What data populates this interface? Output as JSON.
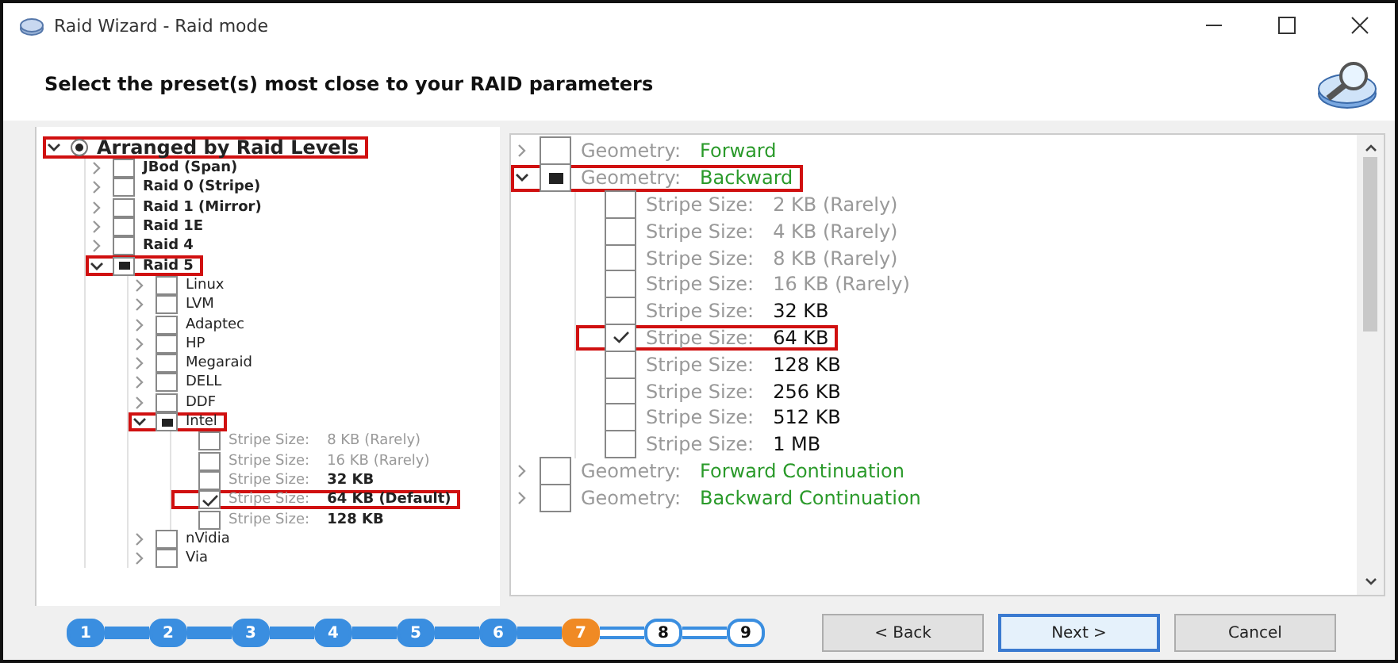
{
  "window": {
    "title": "Raid Wizard - Raid mode"
  },
  "header": {
    "title": "Select the preset(s) most close to your RAID parameters"
  },
  "left_tree": [
    {
      "kind": "radio_group",
      "label": "Arranged by Raid Levels",
      "checked": true,
      "expanded": true,
      "highlighted": true,
      "children": [
        {
          "kind": "group",
          "label": "JBod (Span)",
          "partial": false,
          "expanded": false,
          "highlighted": false
        },
        {
          "kind": "group",
          "label": "Raid 0 (Stripe)",
          "partial": false,
          "expanded": false,
          "highlighted": false
        },
        {
          "kind": "group",
          "label": "Raid 1 (Mirror)",
          "partial": false,
          "expanded": false,
          "highlighted": false
        },
        {
          "kind": "group",
          "label": "Raid 1E",
          "partial": false,
          "expanded": false,
          "highlighted": false
        },
        {
          "kind": "group",
          "label": "Raid 4",
          "partial": false,
          "expanded": false,
          "highlighted": false
        },
        {
          "kind": "group",
          "label": "Raid 5",
          "partial": true,
          "expanded": true,
          "highlighted": true,
          "children": [
            {
              "kind": "group",
              "label": "Linux",
              "partial": false,
              "expanded": false,
              "highlighted": false
            },
            {
              "kind": "group",
              "label": "LVM",
              "partial": false,
              "expanded": false,
              "highlighted": false
            },
            {
              "kind": "group",
              "label": "Adaptec",
              "partial": false,
              "expanded": false,
              "highlighted": false
            },
            {
              "kind": "group",
              "label": "HP",
              "partial": false,
              "expanded": false,
              "highlighted": false
            },
            {
              "kind": "group",
              "label": "Megaraid",
              "partial": false,
              "expanded": false,
              "highlighted": false
            },
            {
              "kind": "group",
              "label": "DELL",
              "partial": false,
              "expanded": false,
              "highlighted": false
            },
            {
              "kind": "group",
              "label": "DDF",
              "partial": false,
              "expanded": false,
              "highlighted": false
            },
            {
              "kind": "group",
              "label": "Intel",
              "partial": true,
              "expanded": true,
              "highlighted": true,
              "children": [
                {
                  "kind": "leaf",
                  "label": "Stripe Size:",
                  "value": "8 KB (Rarely)",
                  "dimmed": true,
                  "checked": false,
                  "highlighted": false
                },
                {
                  "kind": "leaf",
                  "label": "Stripe Size:",
                  "value": "16 KB (Rarely)",
                  "dimmed": true,
                  "checked": false,
                  "highlighted": false
                },
                {
                  "kind": "leaf",
                  "label": "Stripe Size:",
                  "value": "32 KB",
                  "dimmed": false,
                  "checked": false,
                  "highlighted": false
                },
                {
                  "kind": "leaf",
                  "label": "Stripe Size:",
                  "value": "64 KB (Default)",
                  "dimmed": false,
                  "checked": true,
                  "highlighted": true
                },
                {
                  "kind": "leaf",
                  "label": "Stripe Size:",
                  "value": "128 KB",
                  "dimmed": false,
                  "checked": false,
                  "highlighted": false
                }
              ]
            },
            {
              "kind": "group",
              "label": "nVidia",
              "partial": false,
              "expanded": false,
              "highlighted": false
            },
            {
              "kind": "group",
              "label": "Via",
              "partial": false,
              "expanded": false,
              "highlighted": false
            }
          ]
        }
      ]
    }
  ],
  "right_tree": [
    {
      "kind": "group",
      "label": "Geometry:",
      "value": "Forward",
      "partial": false,
      "expanded": false,
      "highlighted": false
    },
    {
      "kind": "group",
      "label": "Geometry:",
      "value": "Backward",
      "partial": true,
      "expanded": true,
      "highlighted": true,
      "children": [
        {
          "kind": "leaf",
          "label": "Stripe Size:",
          "value": "2 KB (Rarely)",
          "dimmed": true,
          "checked": false,
          "highlighted": false
        },
        {
          "kind": "leaf",
          "label": "Stripe Size:",
          "value": "4 KB (Rarely)",
          "dimmed": true,
          "checked": false,
          "highlighted": false
        },
        {
          "kind": "leaf",
          "label": "Stripe Size:",
          "value": "8 KB (Rarely)",
          "dimmed": true,
          "checked": false,
          "highlighted": false
        },
        {
          "kind": "leaf",
          "label": "Stripe Size:",
          "value": "16 KB (Rarely)",
          "dimmed": true,
          "checked": false,
          "highlighted": false
        },
        {
          "kind": "leaf",
          "label": "Stripe Size:",
          "value": "32 KB",
          "dimmed": false,
          "checked": false,
          "highlighted": false
        },
        {
          "kind": "leaf",
          "label": "Stripe Size:",
          "value": "64 KB",
          "dimmed": false,
          "checked": true,
          "highlighted": true
        },
        {
          "kind": "leaf",
          "label": "Stripe Size:",
          "value": "128 KB",
          "dimmed": false,
          "checked": false,
          "highlighted": false
        },
        {
          "kind": "leaf",
          "label": "Stripe Size:",
          "value": "256 KB",
          "dimmed": false,
          "checked": false,
          "highlighted": false
        },
        {
          "kind": "leaf",
          "label": "Stripe Size:",
          "value": "512 KB",
          "dimmed": false,
          "checked": false,
          "highlighted": false
        },
        {
          "kind": "leaf",
          "label": "Stripe Size:",
          "value": "1 MB",
          "dimmed": false,
          "checked": false,
          "highlighted": false
        }
      ]
    },
    {
      "kind": "group",
      "label": "Geometry:",
      "value": "Forward Continuation",
      "partial": false,
      "expanded": false,
      "highlighted": false
    },
    {
      "kind": "group",
      "label": "Geometry:",
      "value": "Backward Continuation",
      "partial": false,
      "expanded": false,
      "highlighted": false
    }
  ],
  "steps": [
    {
      "label": "1",
      "completed": true,
      "selected": false
    },
    {
      "label": "2",
      "completed": true,
      "selected": false
    },
    {
      "label": "3",
      "completed": true,
      "selected": false
    },
    {
      "label": "4",
      "completed": true,
      "selected": false
    },
    {
      "label": "5",
      "completed": true,
      "selected": false
    },
    {
      "label": "6",
      "completed": true,
      "selected": false
    },
    {
      "label": "7",
      "completed": false,
      "selected": true
    },
    {
      "label": "8",
      "completed": false,
      "selected": false
    },
    {
      "label": "9",
      "completed": false,
      "selected": false
    }
  ],
  "buttons": [
    {
      "label": "< Back",
      "default": false
    },
    {
      "label": "Next >",
      "default": true
    },
    {
      "label": "Cancel",
      "default": false
    }
  ]
}
